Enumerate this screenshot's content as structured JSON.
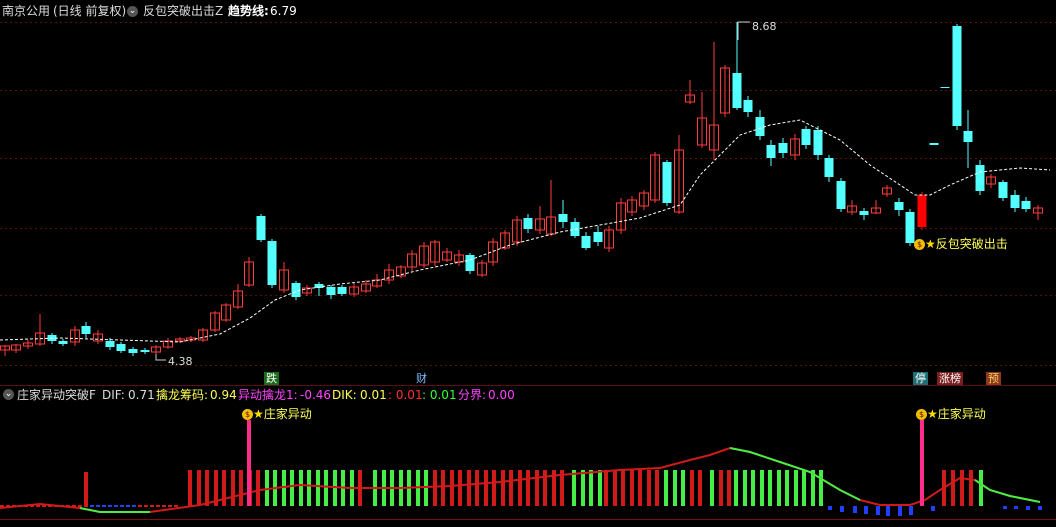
{
  "header": {
    "stock_name": "南京公用",
    "mode": "(日线 前复权)",
    "formula": "反包突破出击Z",
    "trend_label": "趋势线:",
    "trend_value": "6.79"
  },
  "price_chart": {
    "high_label": "8.68",
    "low_label": "4.38",
    "signal_text": "反包突破出击",
    "bull_color": "#ff3c3c",
    "bear_color": "#54ffff",
    "signal_color": "#ff0000"
  },
  "badges": [
    {
      "text": "跌",
      "bg": "#1c6b1c",
      "fg": "#ffffff"
    },
    {
      "text": "财",
      "bg": "#000000",
      "fg": "#7fbfff"
    },
    {
      "text": "停",
      "bg": "#1e6e73",
      "fg": "#ffffff"
    },
    {
      "text": "涨榜",
      "bg": "#7a1e1e",
      "fg": "#ffffff"
    },
    {
      "text": "预",
      "bg": "#8a3a1a",
      "fg": "#ffcc66"
    }
  ],
  "indicator": {
    "name": "庄家异动突破F",
    "dif_label": "DIF:",
    "dif_value": "0.71",
    "chouma_label": "擒龙筹码:",
    "chouma_value": "0.94",
    "yidong_label": "异动擒龙1:",
    "yidong_value": "-0.46",
    "dik_label": "DIK:",
    "dik_value": "0.01",
    "v1": ": 0.01",
    "v2": ": 0.01",
    "fenjie_label": "分界:",
    "fenjie_value": "0.00",
    "signal_text": "庄家异动"
  }
}
